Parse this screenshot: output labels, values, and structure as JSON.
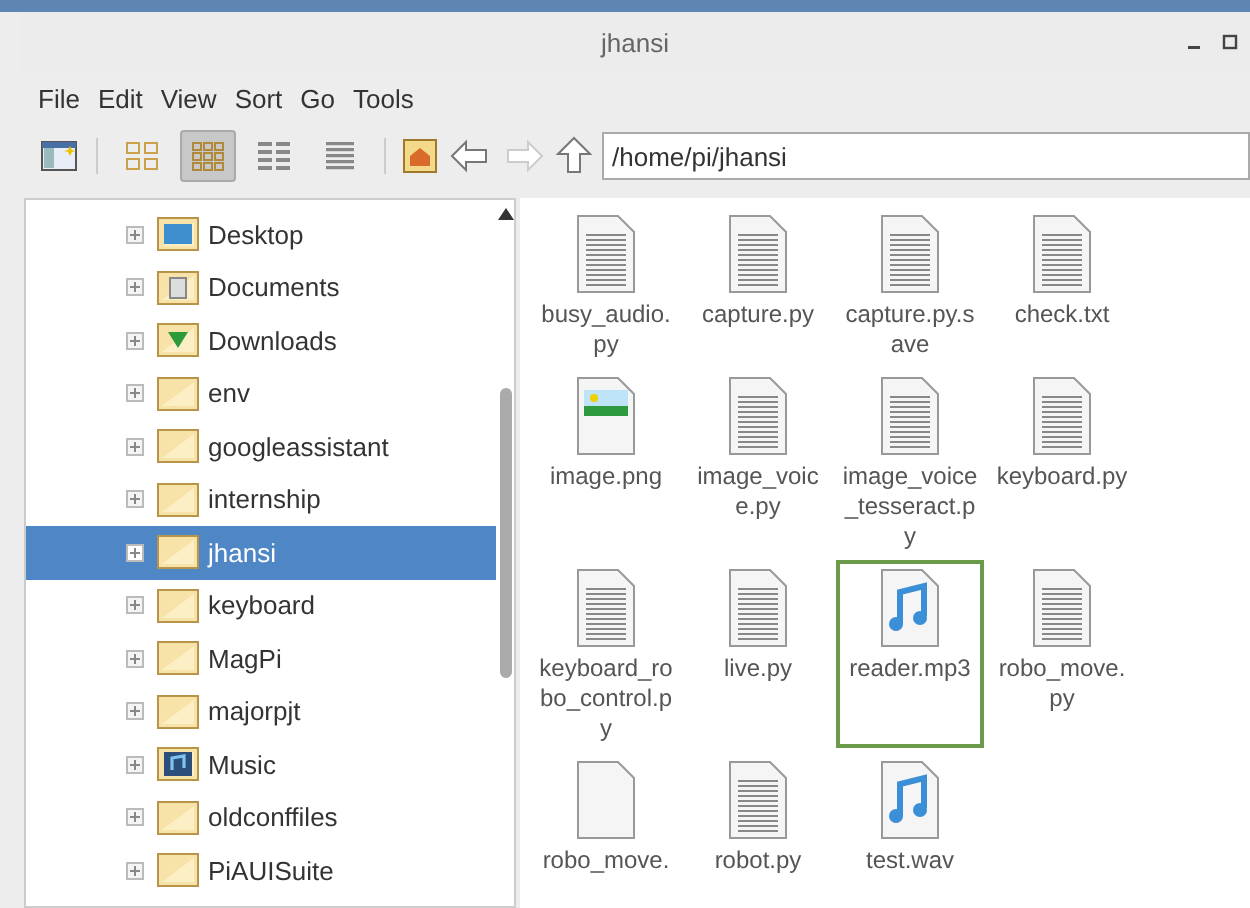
{
  "window": {
    "title": "jhansi"
  },
  "menu": [
    "File",
    "Edit",
    "View",
    "Sort",
    "Go",
    "Tools"
  ],
  "toolbar": {
    "views": [
      {
        "kind": "thumbs",
        "selected": false
      },
      {
        "kind": "icons",
        "selected": true
      },
      {
        "kind": "compact",
        "selected": false
      },
      {
        "kind": "list",
        "selected": false
      }
    ],
    "path": "/home/pi/jhansi"
  },
  "tree": [
    {
      "label": "Desktop",
      "kind": "desktop",
      "selected": false
    },
    {
      "label": "Documents",
      "kind": "documents",
      "selected": false
    },
    {
      "label": "Downloads",
      "kind": "downloads",
      "selected": false
    },
    {
      "label": "env",
      "kind": "folder",
      "selected": false
    },
    {
      "label": "googleassistant",
      "kind": "folder",
      "selected": false
    },
    {
      "label": "internship",
      "kind": "folder",
      "selected": false
    },
    {
      "label": "jhansi",
      "kind": "folder",
      "selected": true
    },
    {
      "label": "keyboard",
      "kind": "folder",
      "selected": false
    },
    {
      "label": "MagPi",
      "kind": "folder",
      "selected": false
    },
    {
      "label": "majorpjt",
      "kind": "folder",
      "selected": false
    },
    {
      "label": "Music",
      "kind": "music",
      "selected": false
    },
    {
      "label": "oldconffiles",
      "kind": "folder",
      "selected": false
    },
    {
      "label": "PiAUISuite",
      "kind": "folder",
      "selected": false
    }
  ],
  "files": [
    {
      "lines": [
        "busy_audio.",
        "py"
      ],
      "kind": "text",
      "selected": false
    },
    {
      "lines": [
        "capture.py"
      ],
      "kind": "text",
      "selected": false
    },
    {
      "lines": [
        "capture.py.s",
        "ave"
      ],
      "kind": "text",
      "selected": false
    },
    {
      "lines": [
        "check.txt"
      ],
      "kind": "text",
      "selected": false
    },
    {
      "lines": [
        "image.png"
      ],
      "kind": "image",
      "selected": false
    },
    {
      "lines": [
        "image_voic",
        "e.py"
      ],
      "kind": "text",
      "selected": false
    },
    {
      "lines": [
        "image_voice",
        "_tesseract.p",
        "y"
      ],
      "kind": "text",
      "selected": false
    },
    {
      "lines": [
        "keyboard.py"
      ],
      "kind": "text",
      "selected": false
    },
    {
      "lines": [
        "keyboard_ro",
        "bo_control.p",
        "y"
      ],
      "kind": "text",
      "selected": false
    },
    {
      "lines": [
        "live.py"
      ],
      "kind": "text",
      "selected": false
    },
    {
      "lines": [
        "reader.mp3"
      ],
      "kind": "audio",
      "selected": true
    },
    {
      "lines": [
        "robo_move.",
        "py"
      ],
      "kind": "text",
      "selected": false
    },
    {
      "lines": [
        "robo_move."
      ],
      "kind": "blank",
      "selected": false
    },
    {
      "lines": [
        "robot.py"
      ],
      "kind": "text",
      "selected": false
    },
    {
      "lines": [
        "test.wav"
      ],
      "kind": "audio",
      "selected": false
    }
  ]
}
